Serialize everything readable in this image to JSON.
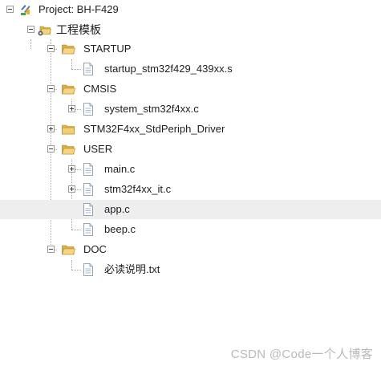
{
  "project": {
    "label": "Project: BH-F429",
    "icon": "project-icon"
  },
  "target": {
    "label": "工程模板",
    "icon": "target-folder-icon"
  },
  "groups": [
    {
      "label": "STARTUP",
      "icon": "folder-open-icon",
      "files": [
        {
          "label": "startup_stm32f429_439xx.s",
          "icon": "file-icon"
        }
      ]
    },
    {
      "label": "CMSIS",
      "icon": "folder-open-icon",
      "files": [
        {
          "label": "system_stm32f4xx.c",
          "icon": "file-icon"
        }
      ]
    },
    {
      "label": "STM32F4xx_StdPeriph_Driver",
      "icon": "folder-closed-icon",
      "files": []
    },
    {
      "label": "USER",
      "icon": "folder-open-icon",
      "files": [
        {
          "label": "main.c",
          "icon": "file-icon"
        },
        {
          "label": "stm32f4xx_it.c",
          "icon": "file-icon"
        },
        {
          "label": "app.c",
          "icon": "file-icon"
        },
        {
          "label": "beep.c",
          "icon": "file-icon"
        }
      ]
    },
    {
      "label": "DOC",
      "icon": "folder-open-icon",
      "files": [
        {
          "label": "必读说明.txt",
          "icon": "file-icon"
        }
      ]
    }
  ],
  "watermark": "CSDN @Code一个人博客"
}
